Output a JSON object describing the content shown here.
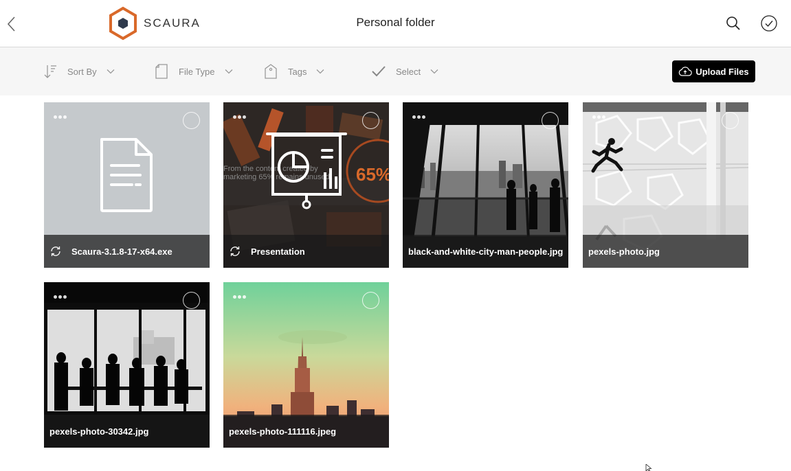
{
  "header": {
    "brand": "SCAURA",
    "title": "Personal folder"
  },
  "toolbar": {
    "sort_by": "Sort By",
    "file_type": "File Type",
    "tags": "Tags",
    "select": "Select",
    "upload": "Upload Files"
  },
  "files": [
    {
      "name": "Scaura-3.1.8-17-x64.exe",
      "kind": "document",
      "syncing": true
    },
    {
      "name": "Presentation",
      "kind": "presentation",
      "syncing": true
    },
    {
      "name": "black-and-white-city-man-people.jpg",
      "kind": "photo",
      "syncing": false
    },
    {
      "name": "pexels-photo.jpg",
      "kind": "photo",
      "syncing": false
    },
    {
      "name": "pexels-photo-30342.jpg",
      "kind": "photo",
      "syncing": false
    },
    {
      "name": "pexels-photo-111116.jpeg",
      "kind": "photo",
      "syncing": false
    }
  ],
  "presentation_thumb": {
    "text": "From the content created by marketing 65% remains unused",
    "percent": "65%"
  },
  "colors": {
    "brand_orange": "#d9692a",
    "brand_dark": "#2f3a4c",
    "toolbar_bg": "#f6f6f6",
    "upload_bg": "#000000",
    "doc_tile_bg": "#c5c9cc"
  }
}
